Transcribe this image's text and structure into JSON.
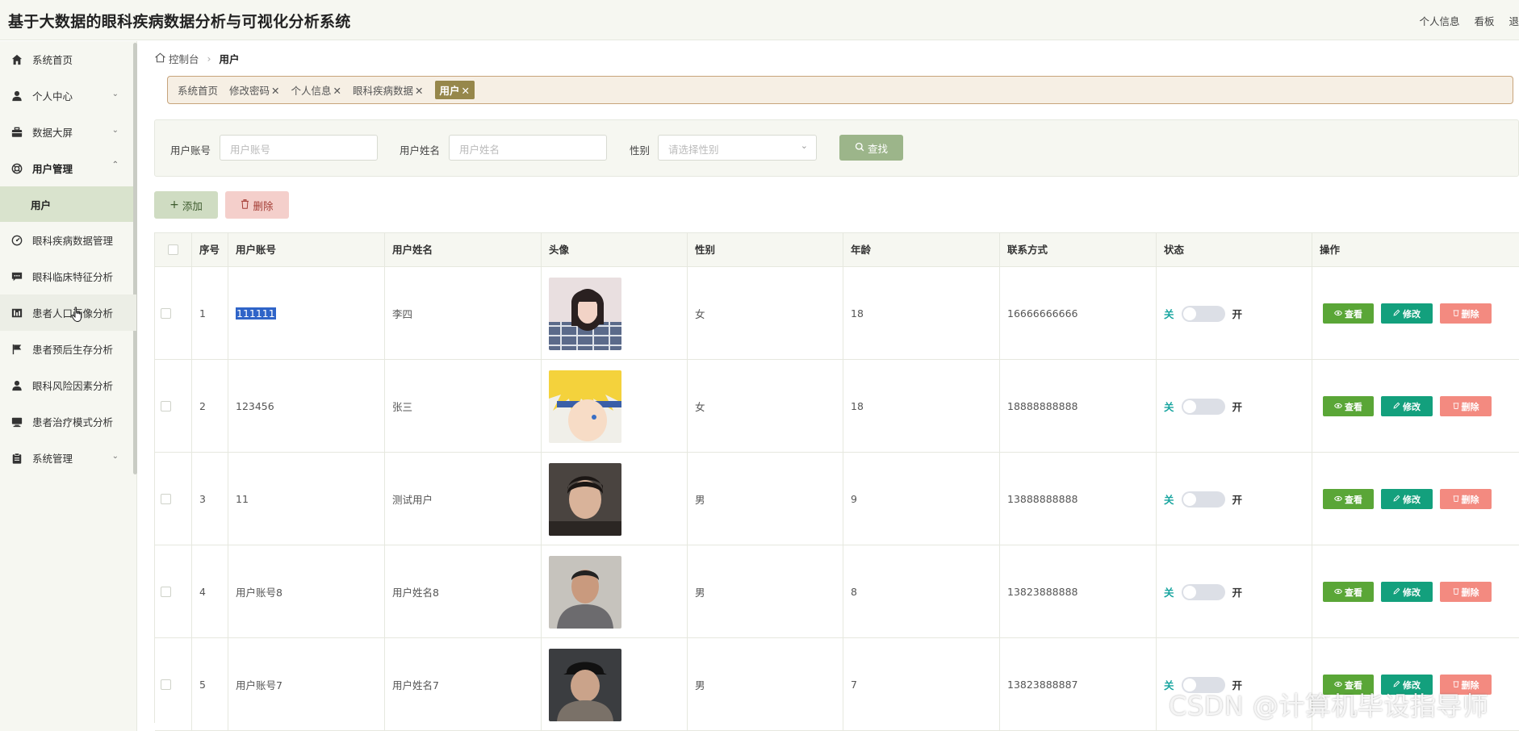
{
  "header": {
    "title": "基于大数据的眼科疾病数据分析与可视化分析系统",
    "links": [
      "个人信息",
      "看板",
      "退"
    ]
  },
  "sidebar": {
    "items": [
      {
        "label": "系统首页",
        "icon": "home-icon",
        "expandable": false
      },
      {
        "label": "个人中心",
        "icon": "user-icon",
        "expandable": true
      },
      {
        "label": "数据大屏",
        "icon": "briefcase-icon",
        "expandable": true
      },
      {
        "label": "用户管理",
        "icon": "lifebuoy-icon",
        "expandable": true,
        "expanded": true,
        "children": [
          "用户"
        ]
      },
      {
        "label": "眼科疾病数据管理",
        "icon": "gauge-icon",
        "expandable": false
      },
      {
        "label": "眼科临床特征分析",
        "icon": "comment-icon",
        "expandable": false
      },
      {
        "label": "患者人口画像分析",
        "icon": "bar-chart-icon",
        "expandable": false
      },
      {
        "label": "患者预后生存分析",
        "icon": "flag-icon",
        "expandable": false
      },
      {
        "label": "眼科风险因素分析",
        "icon": "person-icon",
        "expandable": false
      },
      {
        "label": "患者治疗模式分析",
        "icon": "monitor-icon",
        "expandable": false
      },
      {
        "label": "系统管理",
        "icon": "clipboard-icon",
        "expandable": true
      }
    ]
  },
  "breadcrumb": {
    "home": "控制台",
    "current": "用户"
  },
  "tags": [
    {
      "label": "系统首页",
      "closable": false,
      "active": false
    },
    {
      "label": "修改密码",
      "closable": true,
      "active": false
    },
    {
      "label": "个人信息",
      "closable": true,
      "active": false
    },
    {
      "label": "眼科疾病数据",
      "closable": true,
      "active": false
    },
    {
      "label": "用户",
      "closable": true,
      "active": true
    }
  ],
  "search": {
    "account_label": "用户账号",
    "account_placeholder": "用户账号",
    "name_label": "用户姓名",
    "name_placeholder": "用户姓名",
    "gender_label": "性别",
    "gender_placeholder": "请选择性别",
    "search_button": "查找"
  },
  "actions": {
    "add": "添加",
    "delete": "删除"
  },
  "table": {
    "columns": [
      "序号",
      "用户账号",
      "用户姓名",
      "头像",
      "性别",
      "年龄",
      "联系方式",
      "状态",
      "操作"
    ],
    "status_off": "关",
    "status_on": "开",
    "op_view": "查看",
    "op_edit": "修改",
    "op_delete": "删除",
    "rows": [
      {
        "index": "1",
        "account": "111111",
        "name": "李四",
        "gender": "女",
        "age": "18",
        "phone": "16666666666",
        "avatar": "avatar-girl-photo"
      },
      {
        "index": "2",
        "account": "123456",
        "name": "张三",
        "gender": "女",
        "age": "18",
        "phone": "18888888888",
        "avatar": "avatar-anime-photo"
      },
      {
        "index": "3",
        "account": "11",
        "name": "测试用户",
        "gender": "男",
        "age": "9",
        "phone": "13888888888",
        "avatar": "avatar-boy-photo"
      },
      {
        "index": "4",
        "account": "用户账号8",
        "name": "用户姓名8",
        "gender": "男",
        "age": "8",
        "phone": "13823888888",
        "avatar": "avatar-man-photo"
      },
      {
        "index": "5",
        "account": "用户账号7",
        "name": "用户姓名7",
        "gender": "男",
        "age": "7",
        "phone": "13823888887",
        "avatar": "avatar-cap-photo"
      }
    ]
  },
  "watermark": "CSDN @计算机毕设指导师",
  "colors": {
    "sidebar_bg": "#f6f7f1",
    "active_submenu": "#d9e3cd",
    "active_tag": "#96874b",
    "view_button": "#5aa637",
    "edit_button": "#13a07d",
    "delete_button": "#f38a80",
    "search_button": "#9cb58a"
  }
}
